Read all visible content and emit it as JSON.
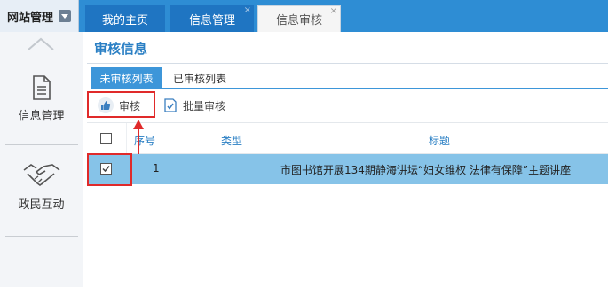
{
  "topbar": {
    "site_menu": "网站管理",
    "tabs": [
      {
        "label": "我的主页",
        "closable": false
      },
      {
        "label": "信息管理",
        "closable": true
      },
      {
        "label": "信息审核",
        "closable": true,
        "active": true
      }
    ],
    "close_glyph": "×"
  },
  "sidebar": {
    "items": [
      {
        "label": "信息管理",
        "icon": "document-icon"
      },
      {
        "label": "政民互动",
        "icon": "handshake-icon"
      }
    ]
  },
  "main": {
    "title": "审核信息",
    "subtabs": [
      "未审核列表",
      "已审核列表"
    ],
    "toolbar": {
      "audit_label": "审核",
      "batch_audit_label": "批量审核"
    },
    "table": {
      "columns": [
        "序号",
        "类型",
        "标题"
      ],
      "rows": [
        {
          "index": "1",
          "type": "",
          "title": "市图书馆开展134期静海讲坛“妇女维权 法律有保障”主题讲座",
          "checked": true,
          "selected": true
        }
      ]
    }
  },
  "colors": {
    "topbar": "#2e8dd4",
    "accent": "#2a7fc4",
    "selected_row": "#86c3e8",
    "highlight": "#e02a2a"
  }
}
